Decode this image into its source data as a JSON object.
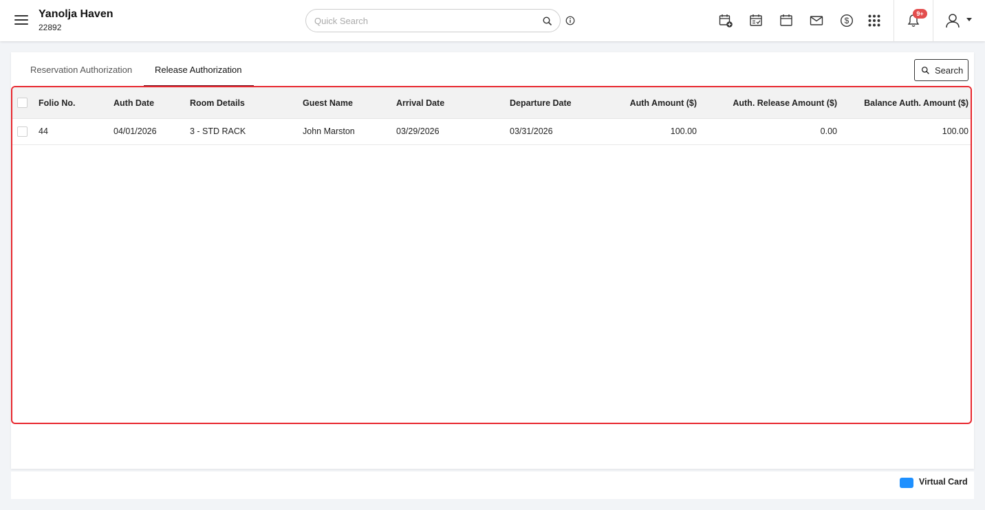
{
  "header": {
    "hotel_name": "Yanolja Haven",
    "hotel_id": "22892",
    "search_placeholder": "Quick Search",
    "notification_badge": "9+"
  },
  "tabs": {
    "reservation": "Reservation Authorization",
    "release": "Release Authorization",
    "active": "release"
  },
  "toolbar": {
    "search_label": "Search"
  },
  "grid": {
    "columns": {
      "folio": "Folio No.",
      "auth_date": "Auth Date",
      "room": "Room Details",
      "guest": "Guest Name",
      "arrival": "Arrival Date",
      "departure": "Departure Date",
      "auth_amount": "Auth Amount ($)",
      "release_amount": "Auth. Release Amount ($)",
      "balance_amount": "Balance Auth. Amount ($)"
    },
    "rows": [
      {
        "folio": "44",
        "auth_date": "04/01/2026",
        "room": "3 - STD RACK",
        "guest": "John Marston",
        "arrival": "03/29/2026",
        "departure": "03/31/2026",
        "auth_amount": "100.00",
        "release_amount": "0.00",
        "balance_amount": "100.00"
      }
    ]
  },
  "legend": {
    "virtual_card": "Virtual Card",
    "virtual_card_color": "#1e90ff"
  },
  "colors": {
    "highlight_border": "#e8262d",
    "tab_accent": "#6b1020",
    "badge": "#e34d4d"
  }
}
